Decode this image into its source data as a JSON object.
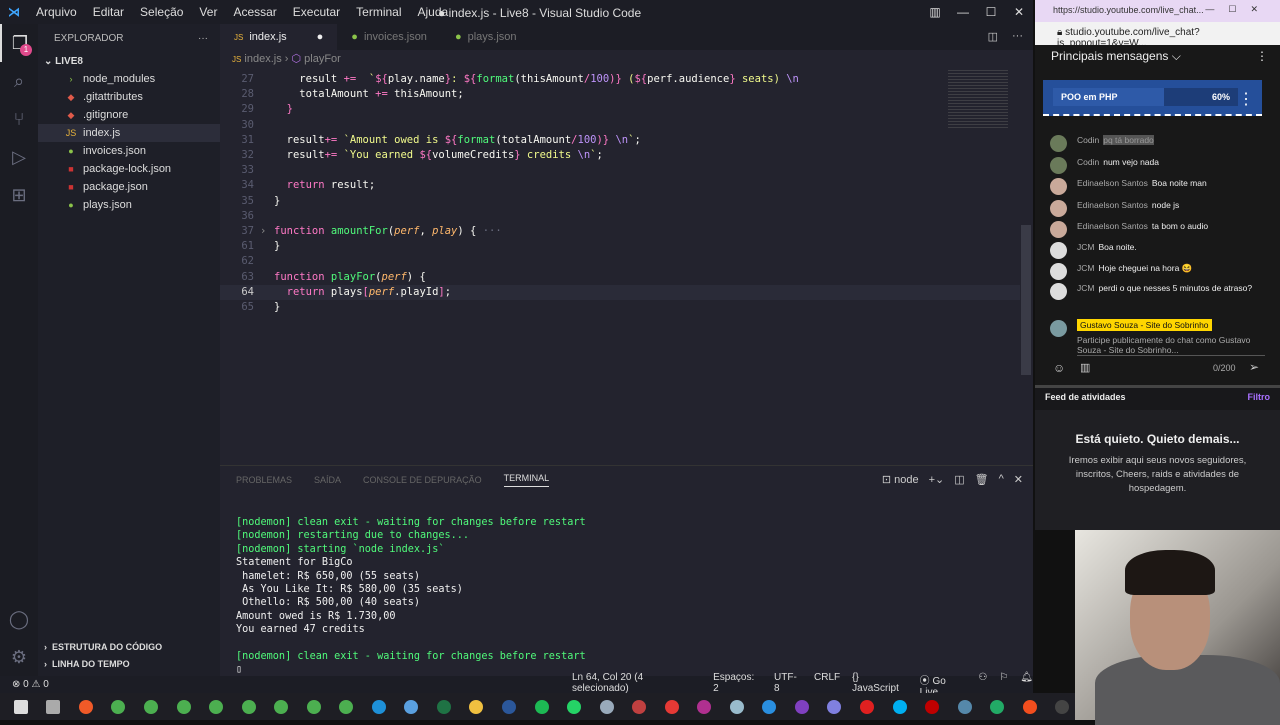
{
  "window": {
    "title": "● index.js - Live8 - Visual Studio Code",
    "menu": [
      "Arquivo",
      "Editar",
      "Seleção",
      "Ver",
      "Acessar",
      "Executar",
      "Terminal",
      "Ajuda"
    ]
  },
  "sidebar": {
    "title": "EXPLORADOR",
    "folder": "LIVE8",
    "badge": "1",
    "files": [
      {
        "name": "node_modules",
        "icon": "folder-icon",
        "color": "#8bc34a",
        "glyph": "›"
      },
      {
        "name": ".gitattributes",
        "icon": "git-icon",
        "color": "#e05a4a",
        "glyph": "◆"
      },
      {
        "name": ".gitignore",
        "icon": "git-icon",
        "color": "#e05a4a",
        "glyph": "◆"
      },
      {
        "name": "index.js",
        "icon": "js-icon",
        "color": "#e8b33c",
        "glyph": "JS",
        "selected": true
      },
      {
        "name": "invoices.json",
        "icon": "json-icon",
        "color": "#8bc34a",
        "glyph": "●"
      },
      {
        "name": "package-lock.json",
        "icon": "npm-icon",
        "color": "#c33",
        "glyph": "■"
      },
      {
        "name": "package.json",
        "icon": "npm-icon",
        "color": "#c33",
        "glyph": "■"
      },
      {
        "name": "plays.json",
        "icon": "json-icon",
        "color": "#8bc34a",
        "glyph": "●"
      }
    ],
    "sections": [
      "ESTRUTURA DO CÓDIGO",
      "LINHA DO TEMPO"
    ]
  },
  "tabs": [
    {
      "label": "index.js",
      "active": true,
      "dirty": "●"
    },
    {
      "label": "invoices.json"
    },
    {
      "label": "plays.json"
    }
  ],
  "breadcrumb": {
    "file": "index.js",
    "symbol": "playFor"
  },
  "code": [
    {
      "n": "27",
      "t": [
        [
          "result ",
          "pl"
        ],
        [
          "+=",
          "kw"
        ],
        [
          "  `",
          "st"
        ],
        [
          "${",
          "kw"
        ],
        [
          "play.name",
          "pl"
        ],
        [
          "}",
          "kw"
        ],
        [
          ": ",
          "st"
        ],
        [
          "${",
          "kw"
        ],
        [
          "format",
          "fn"
        ],
        [
          "(thisAmount",
          "pl"
        ],
        [
          "/",
          "kw"
        ],
        [
          "100",
          "pu"
        ],
        [
          ")}",
          "kw"
        ],
        [
          " (",
          "st"
        ],
        [
          "${",
          "kw"
        ],
        [
          "perf.audience",
          "pl"
        ],
        [
          "}",
          "kw"
        ],
        [
          " seats) ",
          "st"
        ],
        [
          "\\n",
          "pu"
        ]
      ],
      "indent": "    "
    },
    {
      "n": "28",
      "t": [
        [
          "totalAmount ",
          "pl"
        ],
        [
          "+=",
          "kw"
        ],
        [
          " thisAmount;",
          "pl"
        ]
      ],
      "indent": "    "
    },
    {
      "n": "29",
      "t": [
        [
          "}",
          "kw"
        ]
      ],
      "indent": "  "
    },
    {
      "n": "30",
      "t": [],
      "indent": ""
    },
    {
      "n": "31",
      "t": [
        [
          "result",
          "pl"
        ],
        [
          "+=",
          "kw"
        ],
        [
          " `Amount owed is ",
          "st"
        ],
        [
          "${",
          "kw"
        ],
        [
          "format",
          "fn"
        ],
        [
          "(totalAmount",
          "pl"
        ],
        [
          "/",
          "kw"
        ],
        [
          "100",
          "pu"
        ],
        [
          ")}",
          "kw"
        ],
        [
          " ",
          "st"
        ],
        [
          "\\n",
          "pu"
        ],
        [
          "`",
          "st"
        ],
        [
          ";",
          "pl"
        ]
      ],
      "indent": "  "
    },
    {
      "n": "32",
      "t": [
        [
          "result",
          "pl"
        ],
        [
          "+=",
          "kw"
        ],
        [
          " `You earned ",
          "st"
        ],
        [
          "${",
          "kw"
        ],
        [
          "volumeCredits",
          "pl"
        ],
        [
          "}",
          "kw"
        ],
        [
          " credits ",
          "st"
        ],
        [
          "\\n",
          "pu"
        ],
        [
          "`",
          "st"
        ],
        [
          ";",
          "pl"
        ]
      ],
      "indent": "  "
    },
    {
      "n": "33",
      "t": [],
      "indent": ""
    },
    {
      "n": "34",
      "t": [
        [
          "return",
          "kw"
        ],
        [
          " result;",
          "pl"
        ]
      ],
      "indent": "  "
    },
    {
      "n": "35",
      "t": [
        [
          "}",
          "pl"
        ]
      ],
      "indent": ""
    },
    {
      "n": "36",
      "t": [],
      "indent": ""
    },
    {
      "n": "37",
      "t": [
        [
          "function",
          "kw"
        ],
        [
          " ",
          "pl"
        ],
        [
          "amountFor",
          "fn"
        ],
        [
          "(",
          "pl"
        ],
        [
          "perf",
          "pa"
        ],
        [
          ", ",
          "pl"
        ],
        [
          "play",
          "pa"
        ],
        [
          ") { ",
          "pl"
        ],
        [
          "···",
          "cm"
        ]
      ],
      "indent": "",
      "fold": "›"
    },
    {
      "n": "61",
      "t": [
        [
          "}",
          "pl"
        ]
      ],
      "indent": ""
    },
    {
      "n": "62",
      "t": [],
      "indent": ""
    },
    {
      "n": "63",
      "t": [
        [
          "function",
          "kw"
        ],
        [
          " ",
          "pl"
        ],
        [
          "playFor",
          "fn"
        ],
        [
          "(",
          "pl"
        ],
        [
          "perf",
          "pa"
        ],
        [
          ") {",
          "pl"
        ]
      ],
      "indent": ""
    },
    {
      "n": "64",
      "t": [
        [
          "return",
          "kw"
        ],
        [
          " plays",
          "pl"
        ],
        [
          "[",
          "kw"
        ],
        [
          "perf",
          "pa"
        ],
        [
          ".playId",
          "pl"
        ],
        [
          "]",
          "kw"
        ],
        [
          ";",
          "pl"
        ]
      ],
      "indent": "  ",
      "cur": true
    },
    {
      "n": "65",
      "t": [
        [
          "}",
          "pl"
        ]
      ],
      "indent": ""
    }
  ],
  "panel": {
    "tabs": [
      "PROBLEMAS",
      "SAÍDA",
      "CONSOLE DE DEPURAÇÃO",
      "TERMINAL"
    ],
    "shell": "node",
    "terminal": [
      {
        "text": "[nodemon] clean exit - waiting for changes before restart",
        "green": true
      },
      {
        "text": "[nodemon] restarting due to changes...",
        "green": true
      },
      {
        "text": "[nodemon] starting `node index.js`",
        "green": true
      },
      {
        "text": "Statement for BigCo"
      },
      {
        "text": " hamelet: R$ 650,00 (55 seats)"
      },
      {
        "text": " As You Like It: R$ 580,00 (35 seats)"
      },
      {
        "text": " Othello: R$ 500,00 (40 seats)"
      },
      {
        "text": "Amount owed is R$ 1.730,00"
      },
      {
        "text": "You earned 47 credits"
      },
      {
        "text": ""
      },
      {
        "text": "[nodemon] clean exit - waiting for changes before restart",
        "green": true
      },
      {
        "text": "▯"
      }
    ]
  },
  "status": {
    "problems": "⊗ 0 ⚠ 0",
    "position": "Ln 64, Col 20 (4 selecionado)",
    "spaces": "Espaços: 2",
    "encoding": "UTF-8",
    "eol": "CRLF",
    "language": "{} JavaScript",
    "golive": "Go Live"
  },
  "browser": {
    "tab": "https://studio.youtube.com/live_chat...",
    "url": "studio.youtube.com/live_chat?is_popout=1&v=W..."
  },
  "chat": {
    "header": "Principais mensagens ⌵",
    "poll": {
      "label": "POO em PHP",
      "percent": "60%",
      "value": 60
    },
    "messages": [
      {
        "author": "Codin",
        "text": "pq tá borrado",
        "color": "#6a7a5a"
      },
      {
        "author": "Codin",
        "text": "num vejo nada",
        "color": "#6a7a5a"
      },
      {
        "author": "Edinaelson Santos",
        "text": "Boa noite man",
        "color": "#c9a99a"
      },
      {
        "author": "Edinaelson Santos",
        "text": "node js",
        "color": "#c9a99a"
      },
      {
        "author": "Edinaelson Santos",
        "text": "ta bom o audio",
        "color": "#c9a99a"
      },
      {
        "author": "JCM",
        "text": "Boa noite.",
        "color": "#ddd"
      },
      {
        "author": "JCM",
        "text": "Hoje cheguei na hora 😆",
        "color": "#ddd"
      },
      {
        "author": "JCM",
        "text": "perdi o que nesses 5 minutos de atraso?",
        "color": "#ddd"
      }
    ],
    "user": "Gustavo Souza - Site do Sobrinho",
    "placeholder": "Participe publicamente do chat como Gustavo Souza - Site do Sobrinho...",
    "counter": "0/200"
  },
  "feed": {
    "title": "Feed de atividades",
    "filter": "Filtro",
    "quiet": "Está quieto. Quieto demais...",
    "desc": "Iremos exibir aqui seus novos seguidores, inscritos, Cheers, raids e atividades de hospedagem."
  },
  "taskbar": [
    {
      "name": "start",
      "color": "#ddd"
    },
    {
      "name": "task-view",
      "color": "#aaa"
    },
    {
      "name": "brave",
      "color": "#f05a28"
    },
    {
      "name": "chrome",
      "color": "#4caf50"
    },
    {
      "name": "chrome",
      "color": "#4caf50"
    },
    {
      "name": "chrome",
      "color": "#4caf50"
    },
    {
      "name": "chrome",
      "color": "#4caf50"
    },
    {
      "name": "chrome",
      "color": "#4caf50"
    },
    {
      "name": "chrome",
      "color": "#4caf50"
    },
    {
      "name": "chrome",
      "color": "#4caf50"
    },
    {
      "name": "chrome",
      "color": "#4caf50"
    },
    {
      "name": "edge",
      "color": "#1e90d8"
    },
    {
      "name": "app",
      "color": "#5aa0e0"
    },
    {
      "name": "excel",
      "color": "#1f7244"
    },
    {
      "name": "explorer",
      "color": "#f0c040"
    },
    {
      "name": "word",
      "color": "#2b579a"
    },
    {
      "name": "spotify",
      "color": "#1db954"
    },
    {
      "name": "whatsapp",
      "color": "#25d366"
    },
    {
      "name": "app",
      "color": "#9ab"
    },
    {
      "name": "app",
      "color": "#c04040"
    },
    {
      "name": "anydesk",
      "color": "#e53935"
    },
    {
      "name": "app",
      "color": "#b03090"
    },
    {
      "name": "app",
      "color": "#9bc"
    },
    {
      "name": "vscode",
      "color": "#2a8fe0"
    },
    {
      "name": "github",
      "color": "#8040c0"
    },
    {
      "name": "app",
      "color": "#8080e0"
    },
    {
      "name": "obs",
      "color": "#e02020"
    },
    {
      "name": "skype",
      "color": "#00aff0"
    },
    {
      "name": "filezilla",
      "color": "#bf0000"
    },
    {
      "name": "app",
      "color": "#58a"
    },
    {
      "name": "app",
      "color": "#2a6"
    },
    {
      "name": "figma",
      "color": "#f24e1e"
    },
    {
      "name": "app",
      "color": "#444"
    }
  ]
}
